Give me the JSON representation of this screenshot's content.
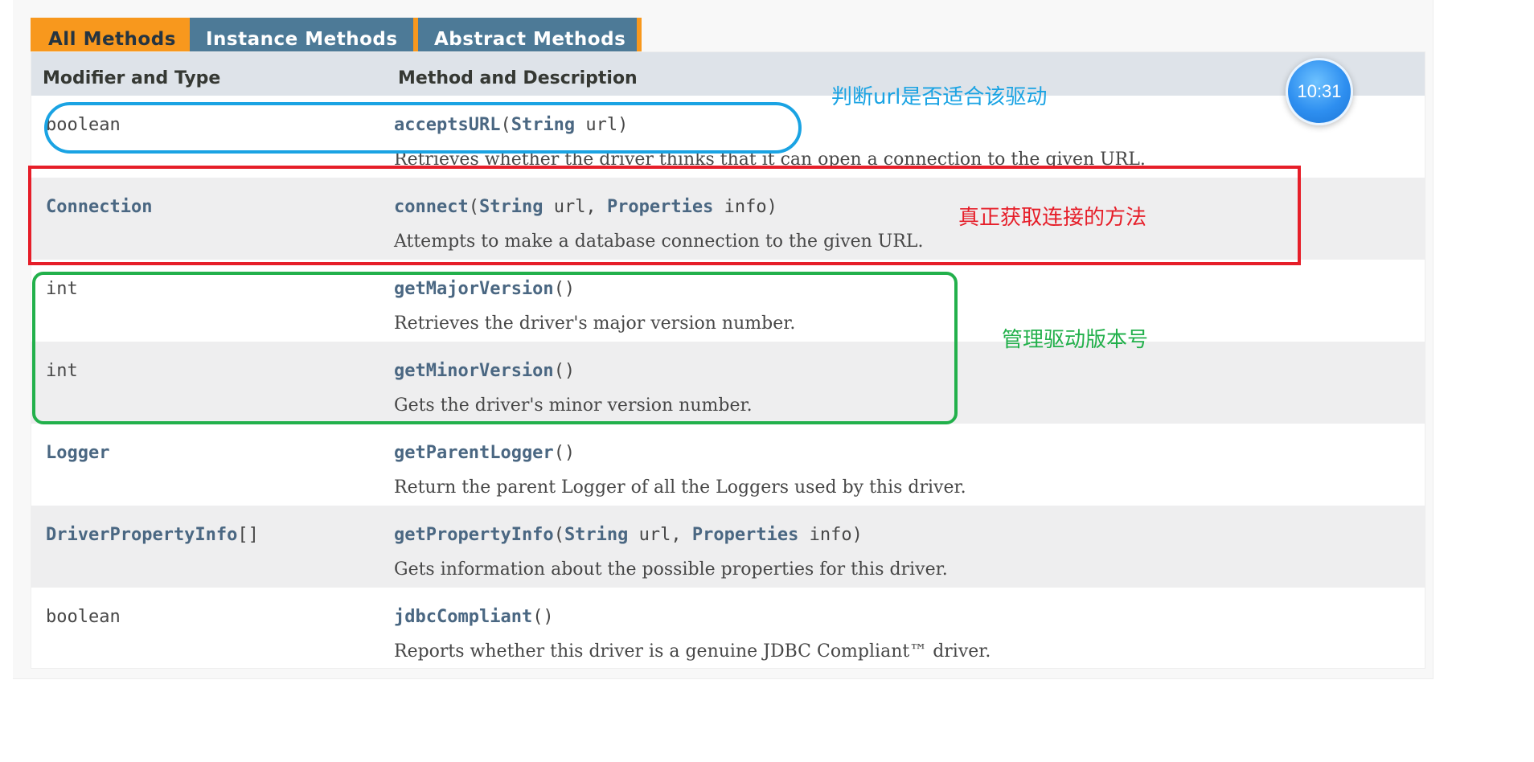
{
  "tabs": [
    "All Methods",
    "Instance Methods",
    "Abstract Methods"
  ],
  "header": {
    "col1": "Modifier and Type",
    "col2": "Method and Description"
  },
  "rows": [
    {
      "type": "boolean",
      "name": "acceptsURL",
      "sig": [
        {
          "t": "(",
          "link": false
        },
        {
          "t": "String",
          "link": true
        },
        {
          "t": " url)",
          "link": false
        }
      ],
      "desc": "Retrieves whether the driver thinks that it can open a connection to the given URL."
    },
    {
      "type": "Connection",
      "name": "connect",
      "sig": [
        {
          "t": "(",
          "link": false
        },
        {
          "t": "String",
          "link": true
        },
        {
          "t": " url, ",
          "link": false
        },
        {
          "t": "Properties",
          "link": true
        },
        {
          "t": " info)",
          "link": false
        }
      ],
      "desc": "Attempts to make a database connection to the given URL."
    },
    {
      "type": "int",
      "name": "getMajorVersion",
      "sig": [
        {
          "t": "()",
          "link": false
        }
      ],
      "desc": "Retrieves the driver's major version number."
    },
    {
      "type": "int",
      "name": "getMinorVersion",
      "sig": [
        {
          "t": "()",
          "link": false
        }
      ],
      "desc": "Gets the driver's minor version number."
    },
    {
      "type": "Logger",
      "name": "getParentLogger",
      "sig": [
        {
          "t": "()",
          "link": false
        }
      ],
      "desc": "Return the parent Logger of all the Loggers used by this driver."
    },
    {
      "type": "DriverPropertyInfo",
      "type_suffix": "[]",
      "name": "getPropertyInfo",
      "sig": [
        {
          "t": "(",
          "link": false
        },
        {
          "t": "String",
          "link": true
        },
        {
          "t": " url, ",
          "link": false
        },
        {
          "t": "Properties",
          "link": true
        },
        {
          "t": " info)",
          "link": false
        }
      ],
      "desc": "Gets information about the possible properties for this driver."
    },
    {
      "type": "boolean",
      "name": "jdbcCompliant",
      "sig": [
        {
          "t": "()",
          "link": false
        }
      ],
      "desc": "Reports whether this driver is a genuine JDBC Compliant™ driver."
    }
  ],
  "annotations": {
    "blue": "判断url是否适合该驱动",
    "red": "真正获取连接的方法",
    "green": "管理驱动版本号"
  },
  "colors": {
    "blue": "#1aa3e3",
    "red": "#e61e29",
    "green": "#22b04b",
    "tab_active": "#f8981d",
    "tab_inactive": "#4d7a97"
  },
  "clock": {
    "time": "10:31"
  }
}
